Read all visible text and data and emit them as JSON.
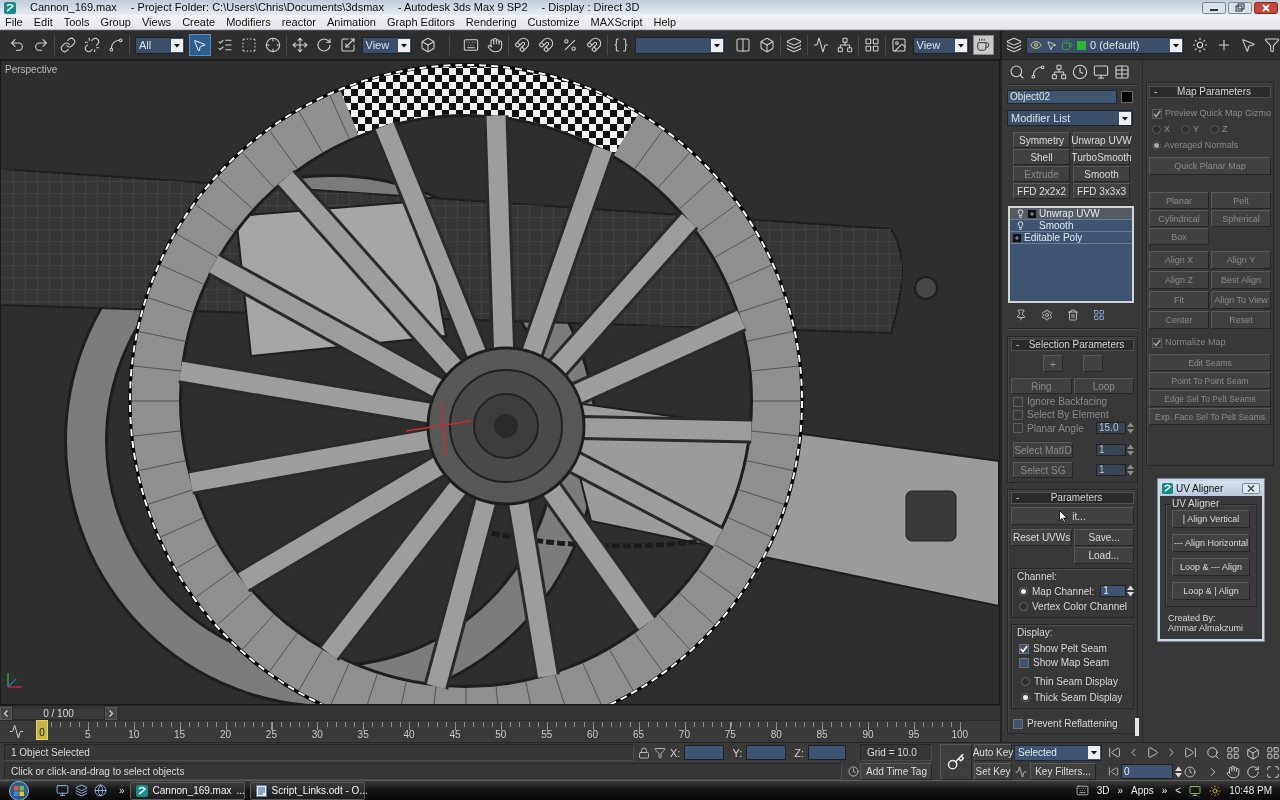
{
  "window": {
    "title_parts": [
      "Cannon_169.max",
      "- Project Folder: C:\\Users\\Chris\\Documents\\3dsmax",
      "- Autodesk 3ds Max 9 SP2",
      "- Display : Direct 3D"
    ]
  },
  "menu": [
    "File",
    "Edit",
    "Tools",
    "Group",
    "Views",
    "Create",
    "Modifiers",
    "reactor",
    "Animation",
    "Graph Editors",
    "Rendering",
    "Customize",
    "MAXScript",
    "Help"
  ],
  "main_toolbar": {
    "select_object_active": true,
    "selection_filter": "All",
    "coordinate_system": "View",
    "render_area": "View"
  },
  "layer_toolbar": {
    "current_layer": "0 (default)"
  },
  "viewport": {
    "label": "Perspective"
  },
  "time_slider": {
    "position": "0 / 100",
    "level": 0
  },
  "track_bar": {
    "ticks": [
      {
        "label": "0",
        "selected": true
      },
      {
        "label": "5",
        "selected": false
      },
      {
        "label": "10",
        "selected": false
      },
      {
        "label": "15",
        "selected": false
      },
      {
        "label": "20",
        "selected": false
      },
      {
        "label": "25",
        "selected": false
      },
      {
        "label": "30",
        "selected": false
      },
      {
        "label": "35",
        "selected": false
      },
      {
        "label": "40",
        "selected": false
      },
      {
        "label": "45",
        "selected": false
      },
      {
        "label": "50",
        "selected": false
      },
      {
        "label": "55",
        "selected": false
      },
      {
        "label": "60",
        "selected": false
      },
      {
        "label": "65",
        "selected": false
      },
      {
        "label": "70",
        "selected": false
      },
      {
        "label": "75",
        "selected": false
      },
      {
        "label": "80",
        "selected": false
      },
      {
        "label": "85",
        "selected": false
      },
      {
        "label": "90",
        "selected": false
      },
      {
        "label": "95",
        "selected": false
      },
      {
        "label": "100",
        "selected": false
      }
    ]
  },
  "status_bar": {
    "selection": "1 Object Selected",
    "prompt": "Click or click-and-drag to select objects",
    "x_label": "X:",
    "y_label": "Y:",
    "z_label": "Z:",
    "grid": "Grid = 10.0",
    "time_tag": "Add Time Tag"
  },
  "animation_controls": {
    "auto_key": "Auto Key",
    "key_mode": "Selected",
    "set_key": "Set Key",
    "key_filters": "Key Filters...",
    "frame": "0"
  },
  "command_panel": {
    "object_name": "Object02",
    "modifier_list": "Modifier List",
    "modifier_buttons": [
      {
        "label": "Symmetry",
        "disabled": false
      },
      {
        "label": "Unwrap UVW",
        "disabled": false
      },
      {
        "label": "Shell",
        "disabled": false
      },
      {
        "label": "TurboSmooth",
        "disabled": false
      },
      {
        "label": "Extrude",
        "disabled": true
      },
      {
        "label": "Smooth",
        "disabled": false
      },
      {
        "label": "FFD 2x2x2",
        "disabled": false
      },
      {
        "label": "FFD 3x3x3",
        "disabled": false
      }
    ],
    "stack": [
      {
        "label": "Unwrap UVW",
        "kind": "modifier",
        "expandable": true,
        "selected": true
      },
      {
        "label": "Smooth",
        "kind": "modifier",
        "expandable": false,
        "selected": false
      },
      {
        "label": "Editable Poly",
        "kind": "object",
        "expandable": true,
        "selected": false
      }
    ]
  },
  "selection_parameters": {
    "toggle": "-",
    "title": "Selection Parameters",
    "disabled": true,
    "grow": "+",
    "ring": "Ring",
    "loop": "Loop",
    "checks": [
      {
        "label": "Ignore Backfacing",
        "checked": false
      },
      {
        "label": "Select By Element",
        "checked": false
      },
      {
        "label": "Planar Angle",
        "checked": false,
        "value": "15.0"
      }
    ],
    "select_matid": {
      "label": "Select MatID",
      "value": "1"
    },
    "select_sg": {
      "label": "Select SG",
      "value": "1"
    }
  },
  "parameters": {
    "toggle": "-",
    "title": "Parameters",
    "edit": "it...",
    "reset": "Reset UVWs",
    "save": "Save...",
    "load": "Load...",
    "channel_group": "Channel:",
    "channels": [
      {
        "label": "Map Channel:",
        "selected": true,
        "value": "1"
      },
      {
        "label": "Vertex Color Channel",
        "selected": false
      }
    ],
    "display_group": "Display:",
    "display_checks": [
      {
        "label": "Show Pelt Seam",
        "checked": true
      },
      {
        "label": "Show Map Seam",
        "checked": false
      }
    ],
    "seam_display": [
      {
        "label": "Thin Seam Display",
        "selected": false
      },
      {
        "label": "Thick Seam Display",
        "selected": true
      }
    ],
    "prevent_reflattening": {
      "label": "Prevent Reflattening",
      "checked": false
    }
  },
  "map_parameters": {
    "toggle": "-",
    "title": "Map Parameters",
    "disabled": true,
    "preview_gizmo": {
      "label": "Preview Quick Map Gizmo",
      "checked": true
    },
    "axes": [
      {
        "label": "X",
        "selected": false
      },
      {
        "label": "Y",
        "selected": false
      },
      {
        "label": "Z",
        "selected": false
      }
    ],
    "averaged_normals": {
      "label": "Averaged Normals",
      "selected": true
    },
    "quick_planar": "Quick Planar Map",
    "projection_buttons": [
      "Planar",
      "Pelt",
      "Cylindrical",
      "Spherical",
      "Box"
    ],
    "align_buttons": [
      "Align X",
      "Align Y",
      "Align Z",
      "Best Align",
      "Fit",
      "Align To View",
      "Center",
      "Reset"
    ],
    "normalize": {
      "label": "Normalize Map",
      "checked": true
    },
    "seam_buttons": [
      "Edit Seams",
      "Point To Point Seam",
      "Edge Sel To Pelt Seams",
      "Exp. Face Sel To Pelt Seams"
    ]
  },
  "uv_aligner": {
    "title": "UV Aligner",
    "group": "UV Aligner",
    "buttons": [
      "| Align Vertical",
      "--- Align Horizontal",
      "Loop & --- Align",
      "Loop & | Align"
    ],
    "credit_heading": "Created By:",
    "credit_name": "Ammar Almakzumi"
  },
  "taskbar": {
    "more": "»",
    "buttons": [
      {
        "label": "Cannon_169.max",
        "suffix": "..."
      },
      {
        "label": "Script_Links.odt - O..."
      }
    ],
    "tray": [
      "3D",
      "»",
      "Apps",
      "»",
      "<"
    ],
    "clock": "10:48 PM"
  }
}
